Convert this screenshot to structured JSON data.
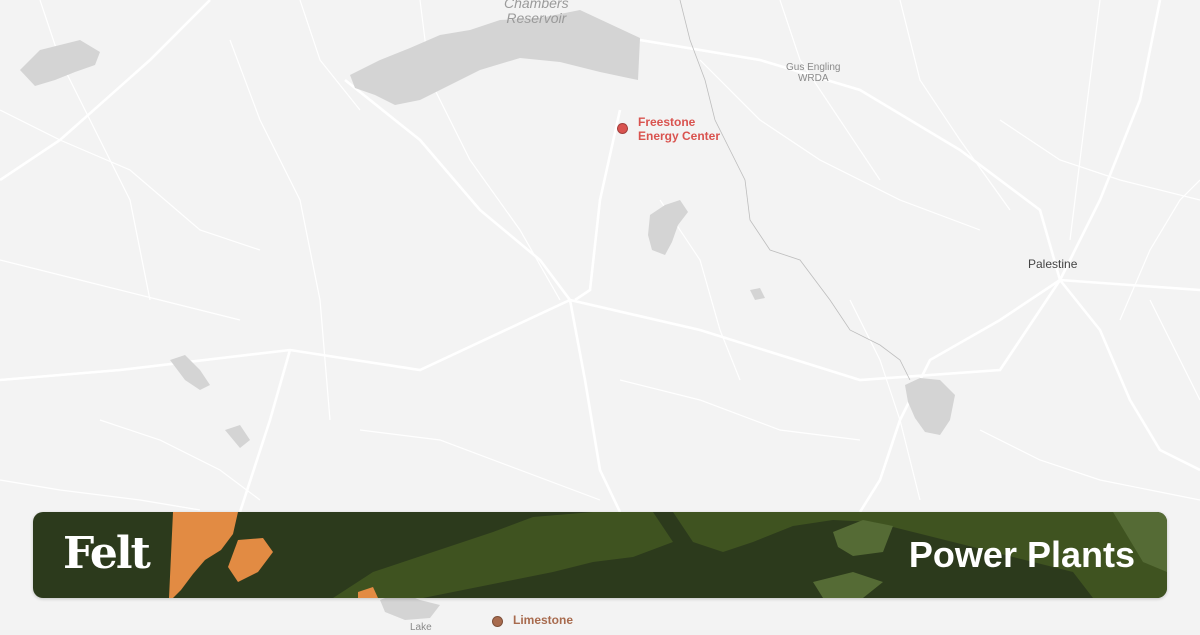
{
  "map": {
    "water_labels": [
      {
        "id": "chambers",
        "lines": [
          "Chambers",
          "Reservoir"
        ]
      }
    ],
    "place_labels": [
      {
        "id": "palestine",
        "text": "Palestine"
      },
      {
        "id": "gus-engling",
        "lines": [
          "Gus Engling",
          "WRDA"
        ]
      }
    ],
    "partial_label": "Lake"
  },
  "plants": [
    {
      "id": "freestone",
      "name_lines": [
        "Freestone",
        "Energy Center"
      ],
      "color": "#d9534f"
    },
    {
      "id": "limestone",
      "name_lines": [
        "Limestone"
      ],
      "color": "#a86b4e"
    }
  ],
  "banner": {
    "brand": "Felt",
    "title": "Power Plants",
    "colors": {
      "dark": "#2c3a1c",
      "mid": "#3f5320",
      "light": "#556b35",
      "accent": "#e28b43"
    }
  }
}
